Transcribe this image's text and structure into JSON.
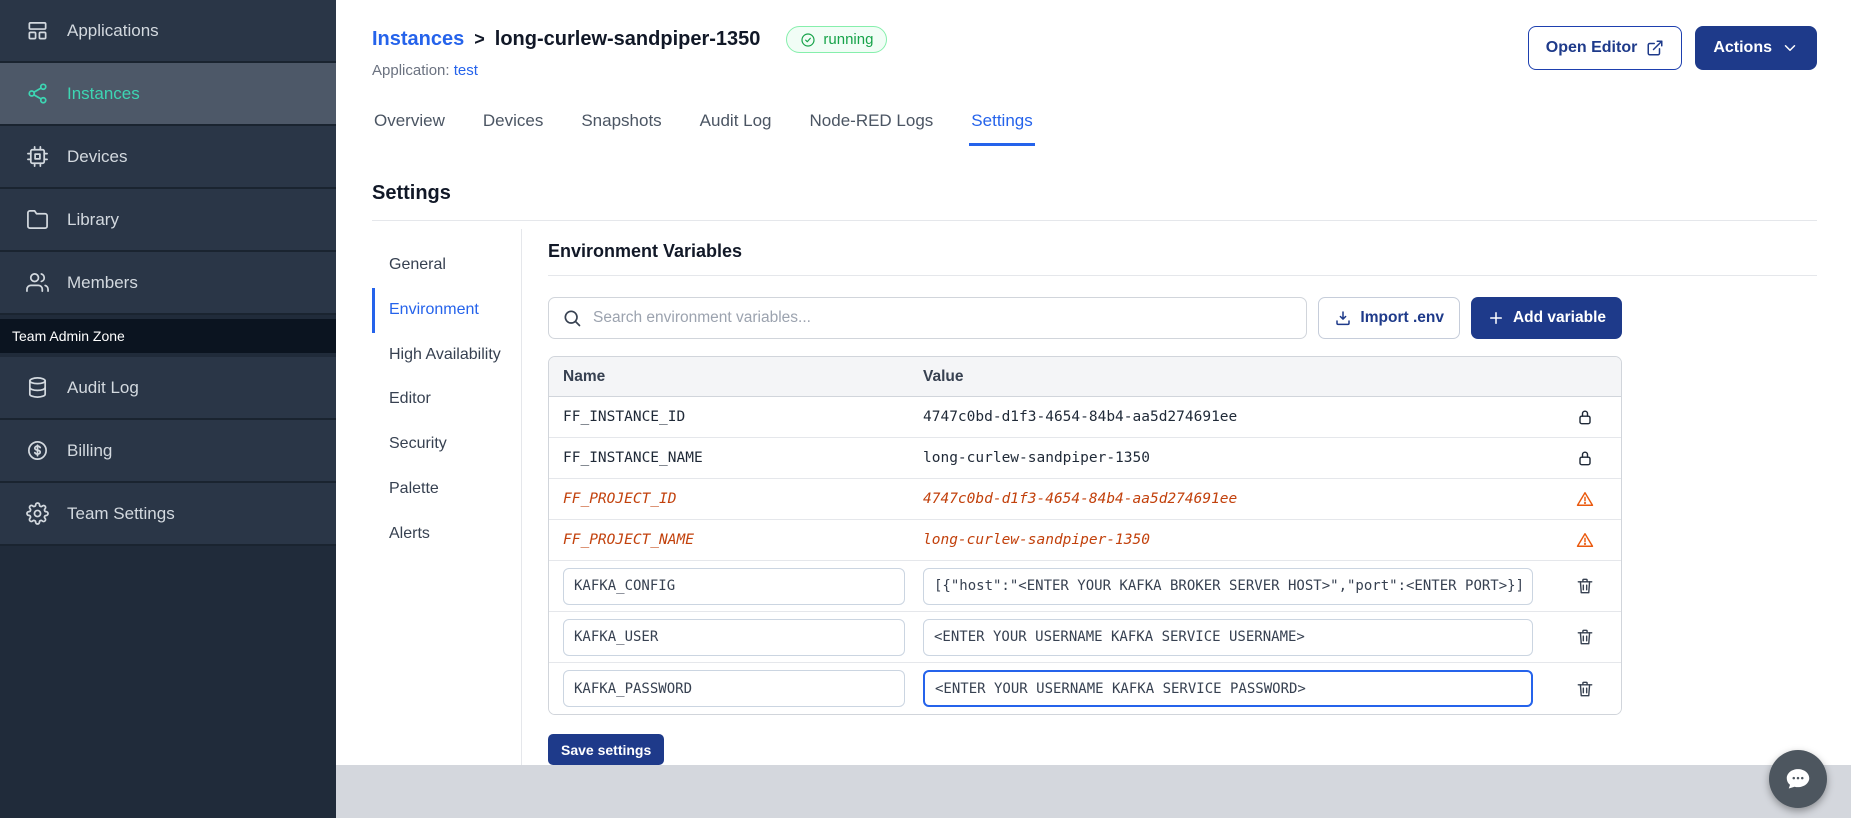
{
  "colors": {
    "primary_button": "#1e3a8a",
    "link_blue": "#2563eb",
    "sidebar_active_teal": "#3dd6b3",
    "running_green": "#17a34a",
    "deprecated_orange": "#c2410c"
  },
  "sidebar": {
    "items": [
      {
        "label": "Applications"
      },
      {
        "label": "Instances"
      },
      {
        "label": "Devices"
      },
      {
        "label": "Library"
      },
      {
        "label": "Members"
      }
    ],
    "section_label": "Team Admin Zone",
    "admin_items": [
      {
        "label": "Audit Log"
      },
      {
        "label": "Billing"
      },
      {
        "label": "Team Settings"
      }
    ]
  },
  "header": {
    "breadcrumb_parent": "Instances",
    "breadcrumb_separator": ">",
    "title": "long-curlew-sandpiper-1350",
    "status_label": "running",
    "application_label": "Application:",
    "application_value": "test",
    "open_editor_label": "Open Editor",
    "actions_label": "Actions"
  },
  "tabs": [
    {
      "label": "Overview"
    },
    {
      "label": "Devices"
    },
    {
      "label": "Snapshots"
    },
    {
      "label": "Audit Log"
    },
    {
      "label": "Node-RED Logs"
    },
    {
      "label": "Settings"
    }
  ],
  "settings": {
    "page_title": "Settings",
    "nav": [
      {
        "label": "General"
      },
      {
        "label": "Environment"
      },
      {
        "label": "High Availability"
      },
      {
        "label": "Editor"
      },
      {
        "label": "Security"
      },
      {
        "label": "Palette"
      },
      {
        "label": "Alerts"
      }
    ],
    "panel_title": "Environment Variables",
    "search_placeholder": "Search environment variables...",
    "import_label": "Import .env",
    "add_label": "Add variable",
    "table": {
      "headers": [
        "Name",
        "Value"
      ],
      "rows": [
        {
          "name": "FF_INSTANCE_ID",
          "value": "4747c0bd-d1f3-4654-84b4-aa5d274691ee",
          "type": "locked"
        },
        {
          "name": "FF_INSTANCE_NAME",
          "value": "long-curlew-sandpiper-1350",
          "type": "locked"
        },
        {
          "name": "FF_PROJECT_ID",
          "value": "4747c0bd-d1f3-4654-84b4-aa5d274691ee",
          "type": "deprecated"
        },
        {
          "name": "FF_PROJECT_NAME",
          "value": "long-curlew-sandpiper-1350",
          "type": "deprecated"
        },
        {
          "name": "KAFKA_CONFIG",
          "value": "[{\"host\":\"<ENTER YOUR KAFKA BROKER SERVER HOST>\",\"port\":<ENTER PORT>}]",
          "type": "editable"
        },
        {
          "name": "KAFKA_USER",
          "value": "<ENTER YOUR USERNAME KAFKA SERVICE USERNAME>",
          "type": "editable"
        },
        {
          "name": "KAFKA_PASSWORD",
          "value": "<ENTER YOUR USERNAME KAFKA SERVICE PASSWORD>",
          "type": "editable",
          "focused": true
        }
      ]
    },
    "save_label": "Save settings"
  }
}
